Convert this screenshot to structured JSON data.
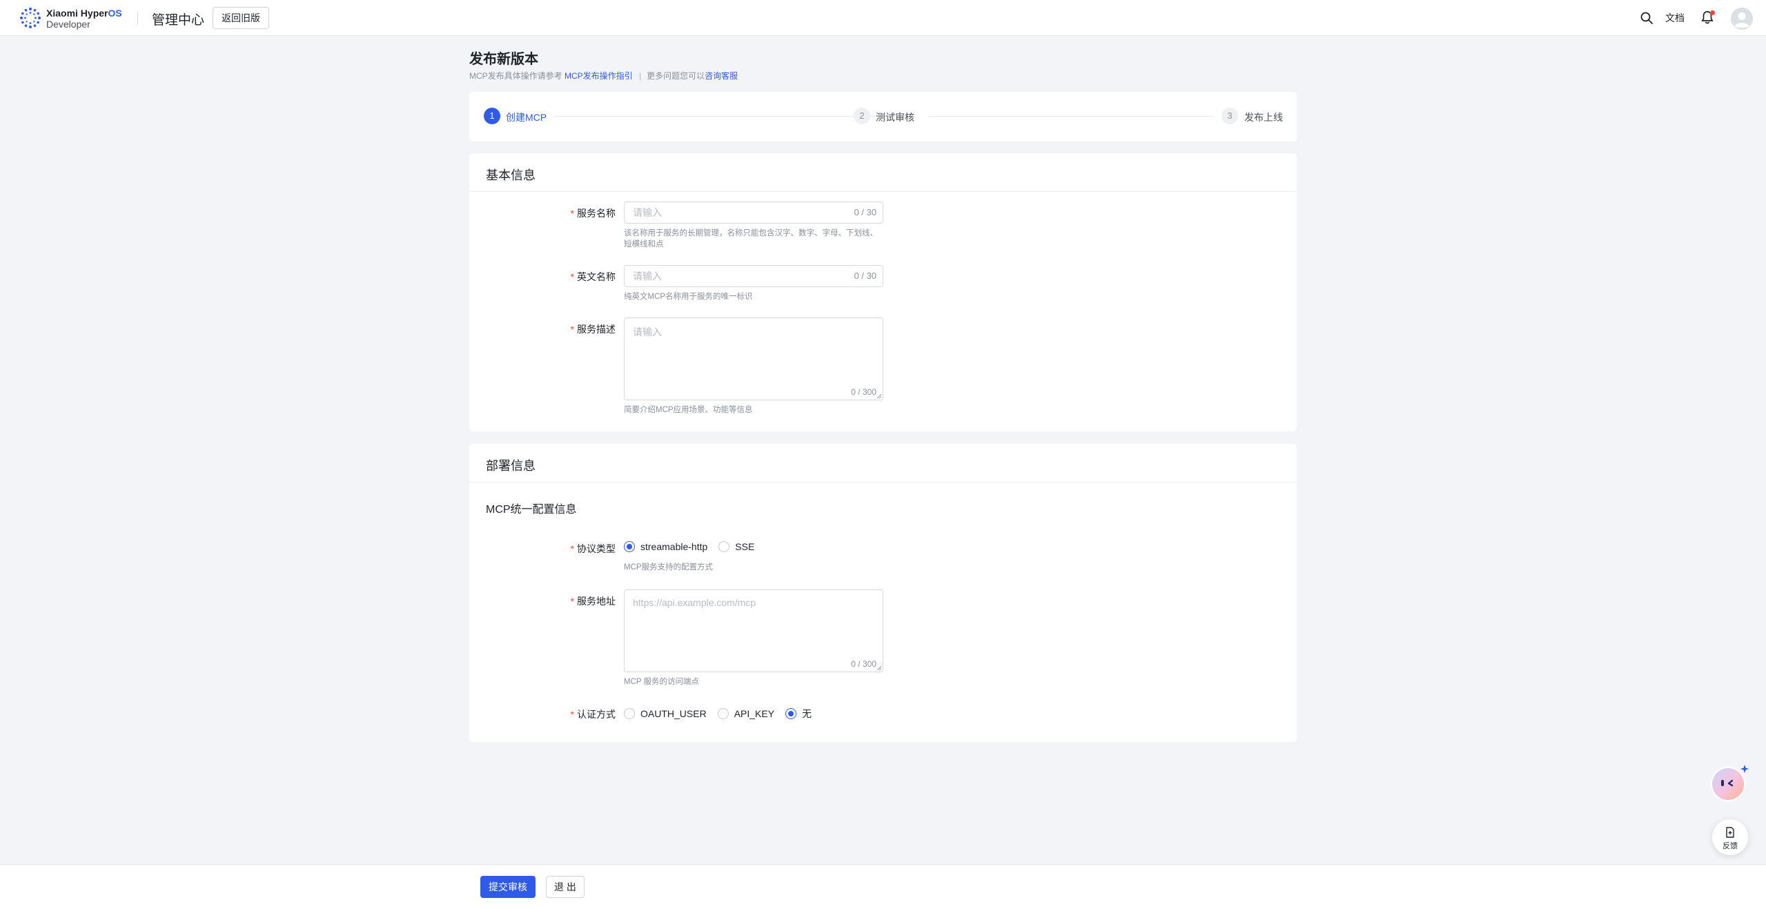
{
  "header": {
    "brand_line1": "Xiaomi Hyper",
    "brand_line1_accent": "OS",
    "brand_line2": "Developer",
    "console_title": "管理中心",
    "back_old_label": "返回旧版",
    "docs_label": "文档",
    "icons": {
      "logo": "hyperos-logo",
      "search": "search-icon",
      "bell": "bell-icon",
      "avatar": "user-avatar-icon"
    }
  },
  "page": {
    "title": "发布新版本",
    "hint_prefix": "MCP发布具体操作请参考",
    "hint_link1": "MCP发布操作指引",
    "hint_separator": "|",
    "hint_middle": "更多问题您可以",
    "hint_link2": "咨询客服"
  },
  "steps": [
    {
      "num": "1",
      "label": "创建MCP",
      "state": "active"
    },
    {
      "num": "2",
      "label": "测试审核",
      "state": "pending"
    },
    {
      "num": "3",
      "label": "发布上线",
      "state": "pending"
    }
  ],
  "basic": {
    "title": "基本信息",
    "service_name": {
      "label": "服务名称",
      "placeholder": "请输入",
      "value": "",
      "counter": "0 / 30",
      "help": "该名称用于服务的长期管理，名称只能包含汉字、数字、字母、下划线、短横线和点"
    },
    "english_name": {
      "label": "英文名称",
      "placeholder": "请输入",
      "value": "",
      "counter": "0 / 30",
      "help": "纯英文MCP名称用于服务的唯一标识"
    },
    "description": {
      "label": "服务描述",
      "placeholder": "请输入",
      "value": "",
      "counter": "0 / 300",
      "help": "简要介绍MCP应用场景、功能等信息"
    }
  },
  "deploy": {
    "title": "部署信息",
    "subtitle": "MCP统一配置信息",
    "protocol": {
      "label": "协议类型",
      "options": [
        "streamable-http",
        "SSE"
      ],
      "selected": "streamable-http",
      "help": "MCP服务支持的配置方式"
    },
    "address": {
      "label": "服务地址",
      "placeholder": "https://api.example.com/mcp",
      "value": "",
      "counter": "0 / 300",
      "help": "MCP 服务的访问端点"
    },
    "auth": {
      "label": "认证方式",
      "options": [
        "OAUTH_USER",
        "API_KEY",
        "无"
      ],
      "selected": "无"
    }
  },
  "floating": {
    "assistant_icon": "ai-assistant-icon",
    "feedback_label": "反馈",
    "feedback_icon": "feedback-icon"
  },
  "footer": {
    "submit_label": "提交审核",
    "exit_label": "退 出"
  },
  "colors": {
    "primary": "#2f5bea",
    "required": "#f5483b",
    "page_bg": "#f3f4f7"
  }
}
